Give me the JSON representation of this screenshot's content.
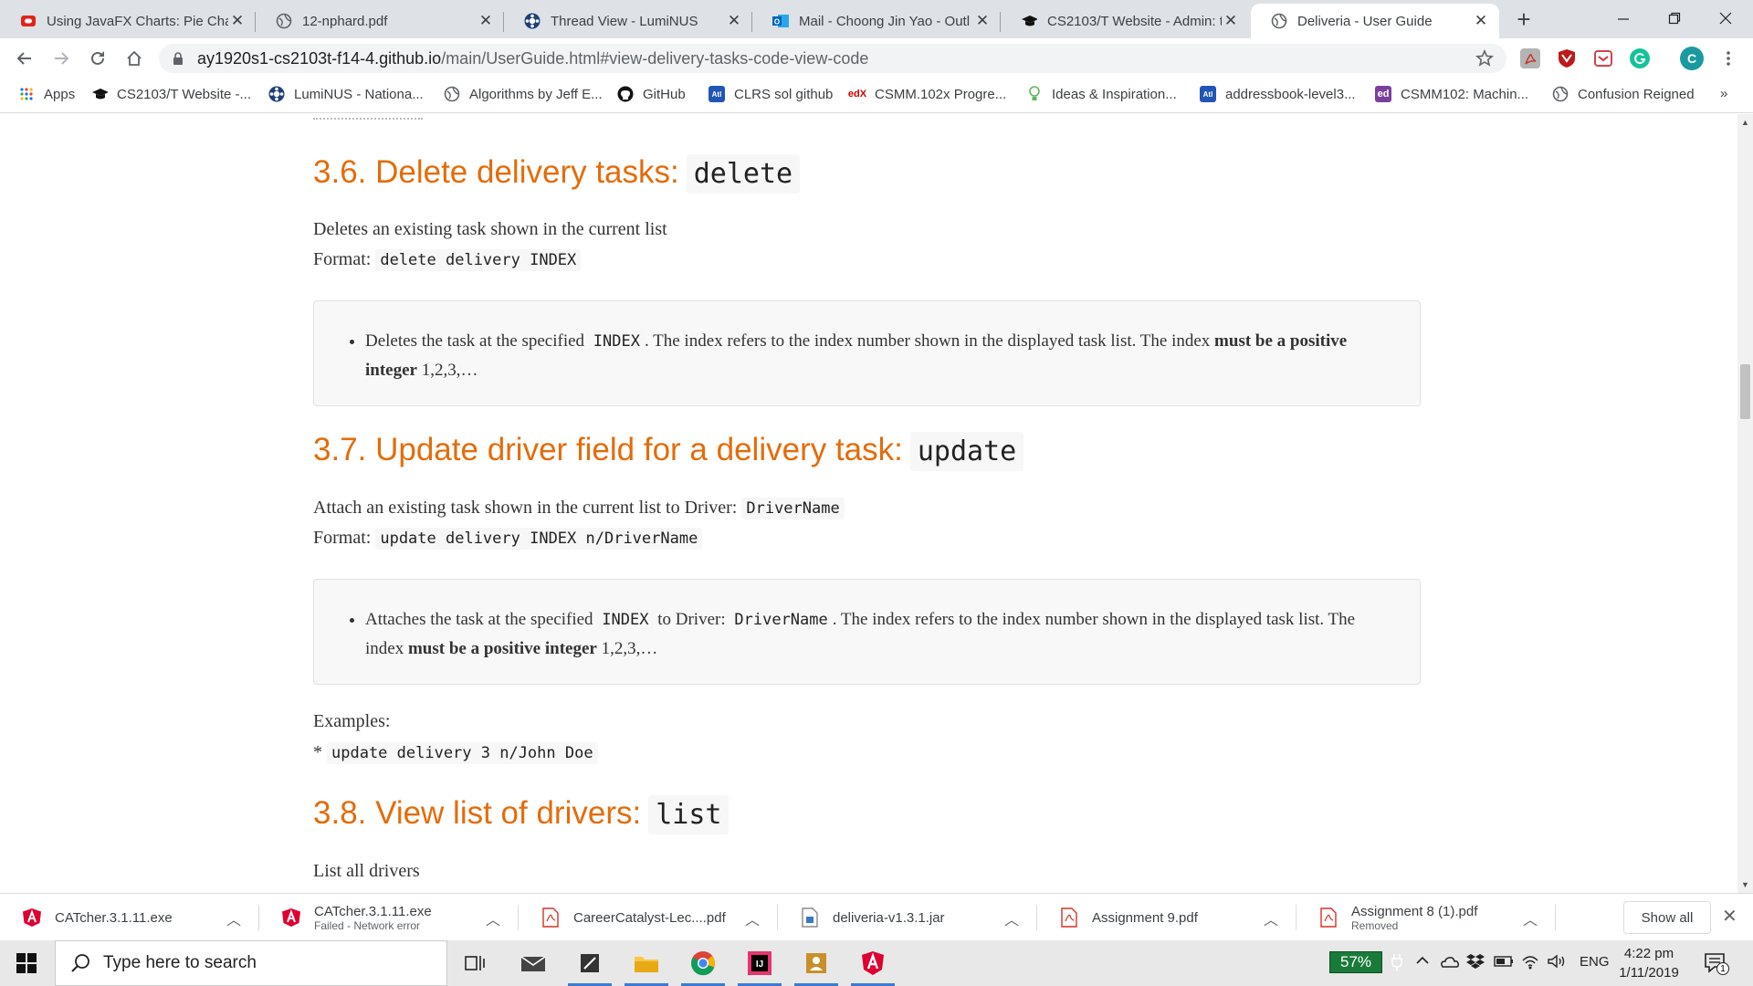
{
  "browser": {
    "tabs": [
      {
        "title": "Using JavaFX Charts: Pie Char",
        "icon": "oracle-icon",
        "active": false
      },
      {
        "title": "12-nphard.pdf",
        "icon": "globe-icon",
        "active": false
      },
      {
        "title": "Thread View - LumiNUS",
        "icon": "luminus-icon",
        "active": false
      },
      {
        "title": "Mail - Choong Jin Yao - Outl",
        "icon": "outlook-icon",
        "active": false
      },
      {
        "title": "CS2103/T Website - Admin: t",
        "icon": "mortarboard-icon",
        "active": false
      },
      {
        "title": "Deliveria - User Guide",
        "icon": "globe-icon",
        "active": true
      }
    ],
    "new_tab": "+",
    "address": {
      "host": "ay1920s1-cs2103t-f14-4.github.io",
      "path": "/main/UserGuide.html#view-delivery-tasks-code-view-code"
    },
    "profile_initial": "C",
    "bookmarks": [
      {
        "label": "Apps",
        "icon": "apps-grid-icon"
      },
      {
        "label": "CS2103/T Website -...",
        "icon": "mortarboard-icon"
      },
      {
        "label": "LumiNUS - Nationa...",
        "icon": "luminus-icon"
      },
      {
        "label": "Algorithms by Jeff E...",
        "icon": "globe-icon"
      },
      {
        "label": "GitHub",
        "icon": "github-icon"
      },
      {
        "label": "CLRS sol github",
        "icon": "atlassian-icon"
      },
      {
        "label": "CSMM.102x Progre...",
        "icon": "edx-icon"
      },
      {
        "label": "Ideas & Inspiration...",
        "icon": "lightbulb-icon"
      },
      {
        "label": "addressbook-level3...",
        "icon": "atlassian-icon"
      },
      {
        "label": "CSMM102: Machin...",
        "icon": "ed-icon"
      },
      {
        "label": "Confusion Reigned",
        "icon": "globe-icon"
      }
    ],
    "bookmarks_overflow": "»"
  },
  "doc": {
    "s36": {
      "heading": "3.6. Delete delivery tasks:",
      "heading_code": "delete",
      "desc": "Deletes an existing task shown in the current list",
      "format_label": "Format:",
      "format_code": "delete delivery INDEX",
      "note_a": "Deletes the task at the specified",
      "note_code": "INDEX",
      "note_b": ". The index refers to the index number shown in the displayed task list. The index",
      "note_bold1": "must be a positive",
      "note_bold2": "integer",
      "note_c": "1,2,3,…"
    },
    "s37": {
      "heading": "3.7. Update driver field for a delivery task:",
      "heading_code": "update",
      "desc": "Attach an existing task shown in the current list to Driver:",
      "desc_code": "DriverName",
      "format_label": "Format:",
      "format_code": "update delivery INDEX n/DriverName",
      "note_a": "Attaches the task at the specified",
      "note_code1": "INDEX",
      "note_b": "to Driver:",
      "note_code2": "DriverName",
      "note_c": ". The index refers to the index number shown in the displayed task list. The",
      "note_d": "index",
      "note_bold": "must be a positive integer",
      "note_e": "1,2,3,…",
      "examples_label": "Examples:",
      "example_bullet": "*",
      "example_code": "update delivery 3 n/John Doe"
    },
    "s38": {
      "heading": "3.8. View list of drivers:",
      "heading_code": "list",
      "desc": "List all drivers"
    }
  },
  "downloads": {
    "items": [
      {
        "name": "CATcher.3.1.11.exe",
        "sub": "",
        "icon": "angular-icon"
      },
      {
        "name": "CATcher.3.1.11.exe",
        "sub": "Failed - Network error",
        "icon": "angular-icon"
      },
      {
        "name": "CareerCatalyst-Lec....pdf",
        "sub": "",
        "icon": "pdf-icon"
      },
      {
        "name": "deliveria-v1.3.1.jar",
        "sub": "",
        "icon": "jar-icon"
      },
      {
        "name": "Assignment 9.pdf",
        "sub": "",
        "icon": "pdf-icon"
      },
      {
        "name": "Assignment 8 (1).pdf",
        "sub": "Removed",
        "icon": "pdf-icon"
      }
    ],
    "show_all": "Show all"
  },
  "taskbar": {
    "search_placeholder": "Type here to search",
    "battery": "57%",
    "language": "ENG",
    "time": "4:22 pm",
    "date": "1/11/2019",
    "notifications": "1"
  }
}
